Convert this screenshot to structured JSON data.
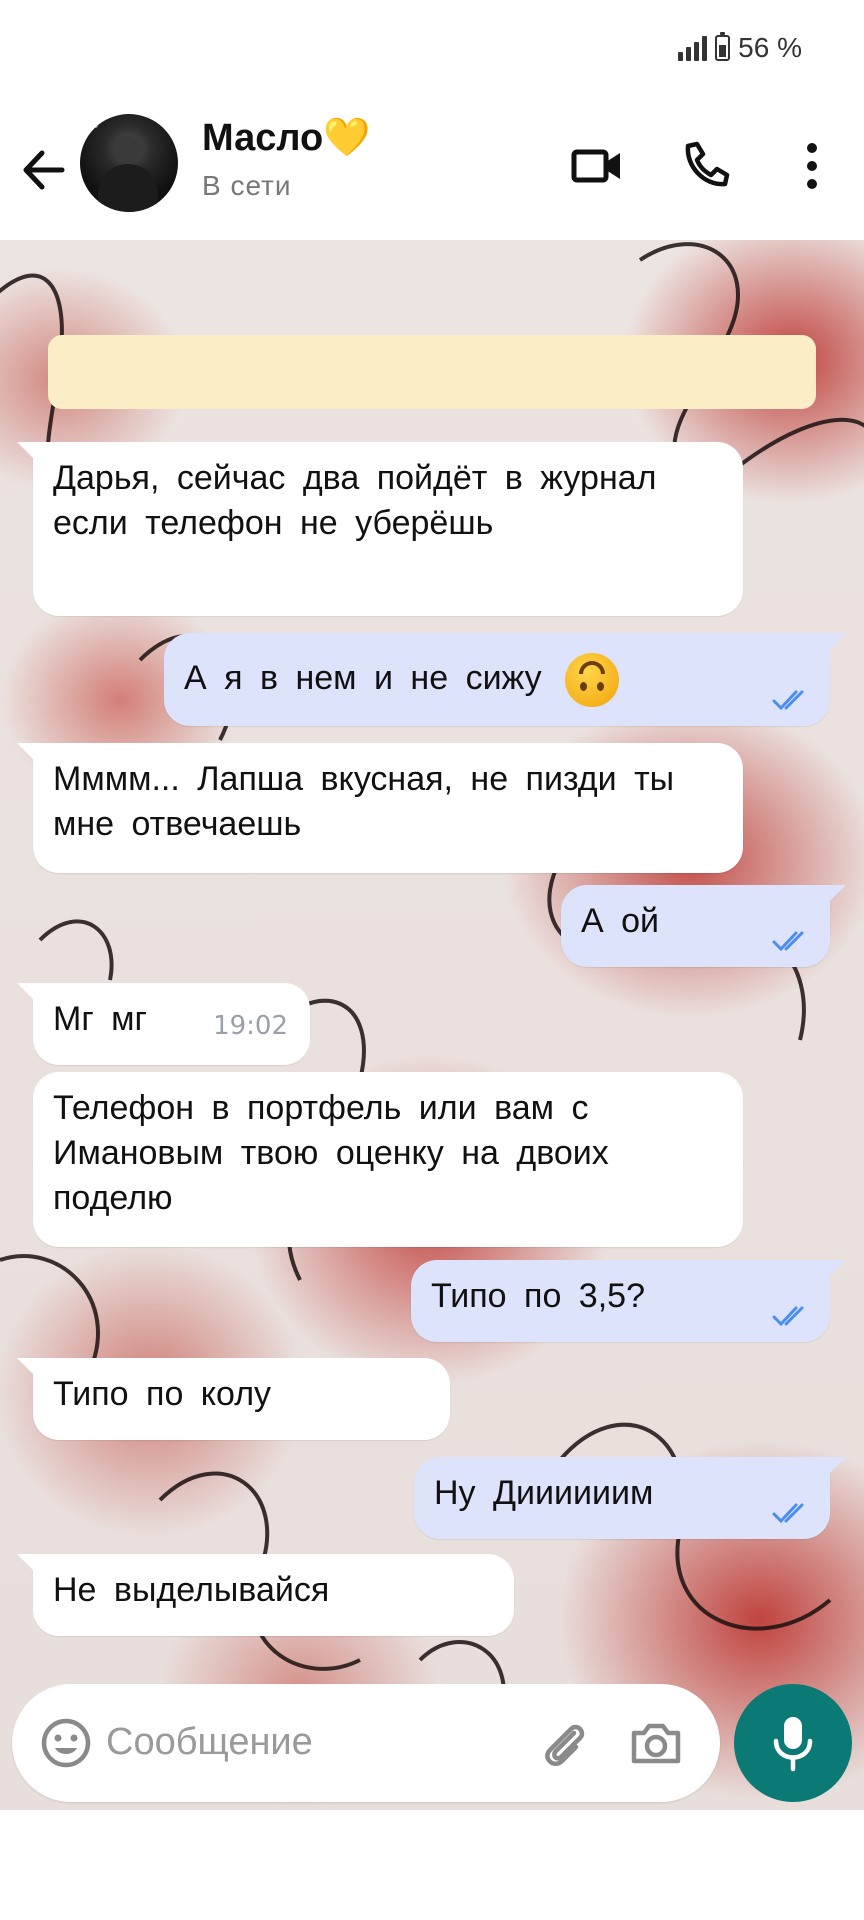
{
  "status_bar": {
    "battery": "56 %"
  },
  "header": {
    "contact_name": "Масло💛",
    "presence": "В сети"
  },
  "messages": [
    {
      "direction": "in",
      "text": "Дарья, сейчас два пойдёт в журнал если телефон не уберёшь"
    },
    {
      "direction": "out",
      "text": "А я в нем и не сижу",
      "emoji": "upside-down-face",
      "status": "read"
    },
    {
      "direction": "in",
      "text": "Мммм... Лапша вкусная, не пизди ты мне отвечаешь"
    },
    {
      "direction": "out",
      "text": "А ой",
      "status": "read"
    },
    {
      "direction": "in",
      "text": "Мг мг",
      "time": "19:02"
    },
    {
      "direction": "in",
      "text": "Телефон в портфель или вам с Имановым твою оценку на двоих поделю"
    },
    {
      "direction": "out",
      "text": "Типо по 3,5?",
      "status": "read"
    },
    {
      "direction": "in",
      "text": "Типо по колу"
    },
    {
      "direction": "out",
      "text": "Ну Диииииим",
      "status": "read"
    },
    {
      "direction": "in",
      "text": "Не выделывайся"
    }
  ],
  "composer": {
    "placeholder": "Сообщение"
  },
  "colors": {
    "accent": "#0b7a75",
    "outgoing_bubble": "#dde3fb",
    "incoming_bubble": "#ffffff",
    "read_ticks": "#4a8df0",
    "banner": "#fbeec7"
  },
  "icons": [
    "signal-icon",
    "battery-icon",
    "back-arrow-icon",
    "video-call-icon",
    "phone-icon",
    "more-icon",
    "emoji-icon",
    "attach-icon",
    "camera-icon",
    "mic-icon",
    "read-ticks-icon"
  ]
}
